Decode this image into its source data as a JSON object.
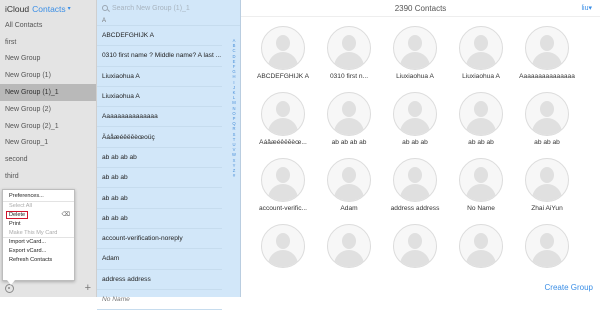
{
  "sidebar": {
    "brand": "iCloud",
    "app": "Contacts",
    "items": [
      {
        "label": "All Contacts",
        "selected": false
      },
      {
        "label": "first",
        "selected": false
      },
      {
        "label": "New Group",
        "selected": false
      },
      {
        "label": "New Group (1)",
        "selected": false
      },
      {
        "label": "New Group (1)_1",
        "selected": true
      },
      {
        "label": "New Group (2)",
        "selected": false
      },
      {
        "label": "New Group (2)_1",
        "selected": false
      },
      {
        "label": "New Group_1",
        "selected": false
      },
      {
        "label": "second",
        "selected": false
      },
      {
        "label": "third",
        "selected": false
      }
    ]
  },
  "menu": {
    "items": [
      {
        "label": "Preferences...",
        "disabled": false
      },
      {
        "label": "Select All",
        "disabled": true
      },
      {
        "label": "Delete",
        "disabled": false,
        "highlighted": true,
        "shortcut": "⌫"
      },
      {
        "label": "Print",
        "disabled": false
      },
      {
        "label": "Make This My Card",
        "disabled": true
      },
      {
        "label": "Import vCard...",
        "disabled": false
      },
      {
        "label": "Export vCard...",
        "disabled": false
      },
      {
        "label": "Refresh Contacts",
        "disabled": false
      }
    ]
  },
  "search": {
    "placeholder": "Search New Group (1)_1"
  },
  "list": {
    "section_letter": "A",
    "rows": [
      "ABCDEFGHIJK A",
      "0310 first name ? Middle name? A last ...",
      "Liuxiaohua A",
      "Liuxiaohua A",
      "Aaaaaaaaaaaaaaa",
      "Äáåæéêëēèœoüç",
      "ab ab ab ab",
      "ab ab ab",
      "ab ab ab",
      "ab ab ab",
      "account-verification-noreply",
      "Adam",
      "address address",
      "No Name"
    ],
    "index": [
      "A",
      "B",
      "C",
      "D",
      "E",
      "F",
      "G",
      "H",
      "I",
      "J",
      "K",
      "L",
      "M",
      "N",
      "O",
      "P",
      "Q",
      "R",
      "S",
      "T",
      "U",
      "V",
      "W",
      "X",
      "Y",
      "Z",
      "#"
    ]
  },
  "main": {
    "count_label": "2390 Contacts",
    "user": "liu",
    "tiles": [
      "ABCDEFGHIJK A",
      "0310 first n...",
      "Liuxiaohua A",
      "Liuxiaohua A",
      "Aaaaaaaaaaaaaaa",
      "Äáåæéêëēèœ...",
      "ab ab ab ab",
      "ab ab ab",
      "ab ab ab",
      "ab ab ab",
      "account-verific...",
      "Adam",
      "address address",
      "No Name",
      "Zhai AiYun",
      "",
      "",
      "",
      "",
      ""
    ],
    "create_group": "Create Group"
  }
}
